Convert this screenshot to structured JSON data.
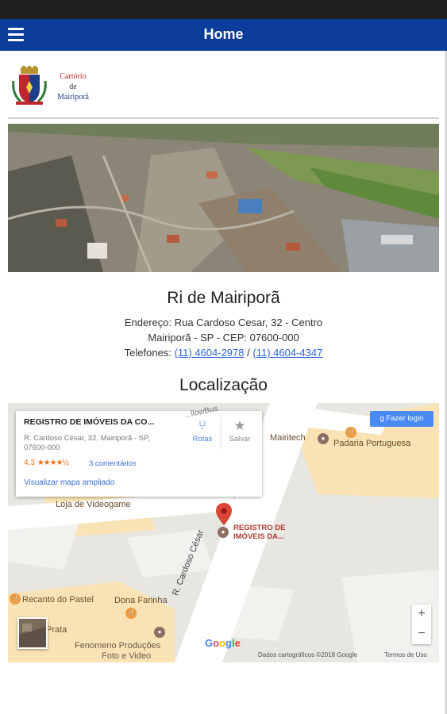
{
  "app": {
    "title": "Home",
    "colors": {
      "appbar": "#0b3e9a",
      "link": "#2a64d8",
      "marker": "#db4437"
    }
  },
  "header": {
    "menu_icon": "hamburger-icon",
    "logo": {
      "line1": "Cartório",
      "line2": "de",
      "line3": "Mairiporã"
    }
  },
  "office": {
    "name": "Ri de Mairiporã",
    "address_line1": "Endereço: Rua Cardoso Cesar, 32 - Centro",
    "address_line2": "Mairiporã - SP - CEP: 07600-000",
    "phones_label": "Telefones:",
    "phone1": "(11) 4604-2978",
    "phone_sep": "/",
    "phone2": "(11) 4604-4347"
  },
  "location": {
    "heading": "Localização",
    "card": {
      "title": "REGISTRO DE IMÓVEIS DA CO...",
      "address": "R. Cardoso César, 32, Mairiporã - SP, 07600-000",
      "rating": "4,3",
      "stars": "★★★★½",
      "reviews": "3 comentários",
      "view_larger": "Visualizar mapa ampliado",
      "directions": "Rotas",
      "save": "Salvar"
    },
    "login": "Fazer login",
    "zoom_in": "+",
    "zoom_out": "−",
    "google": "Google",
    "map_data": "Dados cartográficos ©2018 Google",
    "terms": "Termos de Uso",
    "labels": {
      "mairitech": "Mairitech",
      "padaria": "Padaria Portuguesa",
      "videogame": "Loja de Videogame",
      "registro": "REGISTRO DE",
      "registro2": "IMÓVEIS DA...",
      "recanto": "Recanto do Pastel",
      "dona_farinha": "Dona Farinha",
      "prata": "Prata",
      "fenomeno1": "Fenomeno Produções",
      "fenomeno2": "Foto e Video",
      "street": "R. Cardoso César",
      "street_top": "...llowBus"
    }
  }
}
